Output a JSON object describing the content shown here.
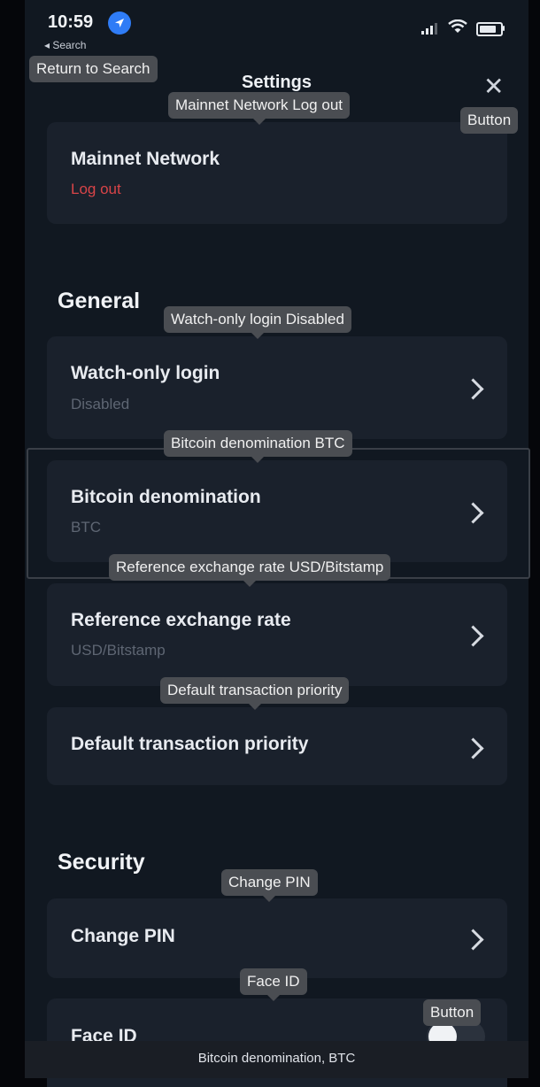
{
  "status": {
    "time": "10:59",
    "back_label": "◂ Search",
    "location_icon": "location-arrow-icon",
    "signal_icon": "cellular-signal-icon",
    "wifi_icon": "wifi-icon",
    "battery_icon": "battery-icon"
  },
  "header": {
    "title": "Settings",
    "close_glyph": "✕"
  },
  "network_card": {
    "title": "Mainnet Network",
    "action": "Log out"
  },
  "general": {
    "heading": "General",
    "items": [
      {
        "title": "Watch-only login",
        "value": "Disabled"
      },
      {
        "title": "Bitcoin denomination",
        "value": "BTC"
      },
      {
        "title": "Reference exchange rate",
        "value": "USD/Bitstamp"
      },
      {
        "title": "Default transaction priority",
        "value": ""
      }
    ]
  },
  "security": {
    "heading": "Security",
    "items": [
      {
        "title": "Change PIN"
      },
      {
        "title": "Face ID"
      }
    ]
  },
  "tooltips": {
    "return_to_search": "Return to Search",
    "network": "Mainnet Network Log out",
    "close_button": "Button",
    "watch_only": "Watch-only login Disabled",
    "denomination": "Bitcoin denomination BTC",
    "exchange_rate": "Reference exchange rate USD/Bitstamp",
    "priority": "Default transaction priority",
    "change_pin": "Change PIN",
    "face_id": "Face ID",
    "toggle_button": "Button"
  },
  "bottom_caption": "Bitcoin denomination, BTC",
  "colors": {
    "background": "#111821",
    "card": "#1a212c",
    "logout": "#d84448",
    "location_badge": "#2f7cf6"
  }
}
